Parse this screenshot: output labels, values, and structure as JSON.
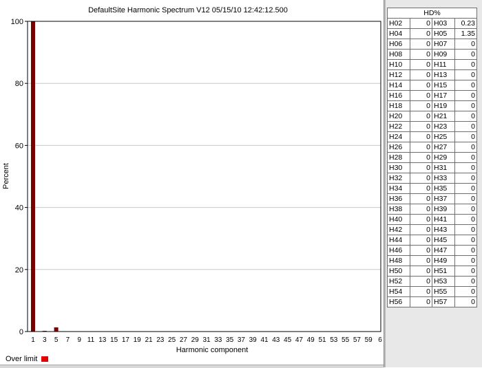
{
  "chart_data": {
    "type": "bar",
    "title": "DefaultSite  Harmonic Spectrum V12  05/15/10  12:42:12.500",
    "xlabel": "Harmonic component",
    "ylabel": "Percent",
    "ylim": [
      0,
      100
    ],
    "yticks": [
      0,
      20,
      40,
      60,
      80,
      100
    ],
    "grid": true,
    "bar_color": "#7a0000",
    "xtick_labels": [
      "1",
      "3",
      "5",
      "7",
      "9",
      "11",
      "13",
      "15",
      "17",
      "19",
      "21",
      "23",
      "25",
      "27",
      "29",
      "31",
      "33",
      "35",
      "37",
      "39",
      "41",
      "43",
      "45",
      "47",
      "49",
      "51",
      "53",
      "55",
      "57",
      "59",
      "6"
    ],
    "bars": [
      {
        "h": 1,
        "value": 100
      },
      {
        "h": 3,
        "value": 0.23
      },
      {
        "h": 5,
        "value": 1.35
      }
    ]
  },
  "legend": {
    "label": "Over limit",
    "color": "#e00000"
  },
  "hd_table": {
    "header": "HD%",
    "rows": [
      [
        "H02",
        "0",
        "H03",
        "0.23"
      ],
      [
        "H04",
        "0",
        "H05",
        "1.35"
      ],
      [
        "H06",
        "0",
        "H07",
        "0"
      ],
      [
        "H08",
        "0",
        "H09",
        "0"
      ],
      [
        "H10",
        "0",
        "H11",
        "0"
      ],
      [
        "H12",
        "0",
        "H13",
        "0"
      ],
      [
        "H14",
        "0",
        "H15",
        "0"
      ],
      [
        "H16",
        "0",
        "H17",
        "0"
      ],
      [
        "H18",
        "0",
        "H19",
        "0"
      ],
      [
        "H20",
        "0",
        "H21",
        "0"
      ],
      [
        "H22",
        "0",
        "H23",
        "0"
      ],
      [
        "H24",
        "0",
        "H25",
        "0"
      ],
      [
        "H26",
        "0",
        "H27",
        "0"
      ],
      [
        "H28",
        "0",
        "H29",
        "0"
      ],
      [
        "H30",
        "0",
        "H31",
        "0"
      ],
      [
        "H32",
        "0",
        "H33",
        "0"
      ],
      [
        "H34",
        "0",
        "H35",
        "0"
      ],
      [
        "H36",
        "0",
        "H37",
        "0"
      ],
      [
        "H38",
        "0",
        "H39",
        "0"
      ],
      [
        "H40",
        "0",
        "H41",
        "0"
      ],
      [
        "H42",
        "0",
        "H43",
        "0"
      ],
      [
        "H44",
        "0",
        "H45",
        "0"
      ],
      [
        "H46",
        "0",
        "H47",
        "0"
      ],
      [
        "H48",
        "0",
        "H49",
        "0"
      ],
      [
        "H50",
        "0",
        "H51",
        "0"
      ],
      [
        "H52",
        "0",
        "H53",
        "0"
      ],
      [
        "H54",
        "0",
        "H55",
        "0"
      ],
      [
        "H56",
        "0",
        "H57",
        "0"
      ]
    ]
  }
}
